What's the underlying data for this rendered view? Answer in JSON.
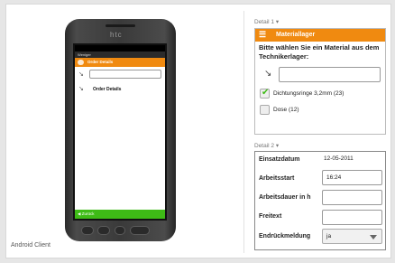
{
  "caption": "Android Client",
  "phone": {
    "brand": "htc",
    "app_title": "Weniger",
    "orange_bar": "Order Details",
    "row_label": "Order Details",
    "back_bar": "◀ Zurück"
  },
  "detail1": {
    "section_label": "Detail 1 ▾",
    "header": "Materiallager",
    "prompt": "Bitte wählen Sie ein Material aus dem Technikerlager:",
    "scan_value": "",
    "items": [
      {
        "label": "Dichtungsringe 3,2mm (23)",
        "checked": true
      },
      {
        "label": "Dose (12)",
        "checked": false
      }
    ]
  },
  "detail2": {
    "section_label": "Detail 2 ▾",
    "rows": [
      {
        "label": "Einsatzdatum",
        "value": "12-05-2011"
      },
      {
        "label": "Arbeitsstart",
        "value": "16:24"
      },
      {
        "label": "Arbeitsdauer in h",
        "value": ""
      },
      {
        "label": "Freitext",
        "value": ""
      },
      {
        "label": "Endrückmeldung",
        "value": "ja"
      }
    ]
  }
}
